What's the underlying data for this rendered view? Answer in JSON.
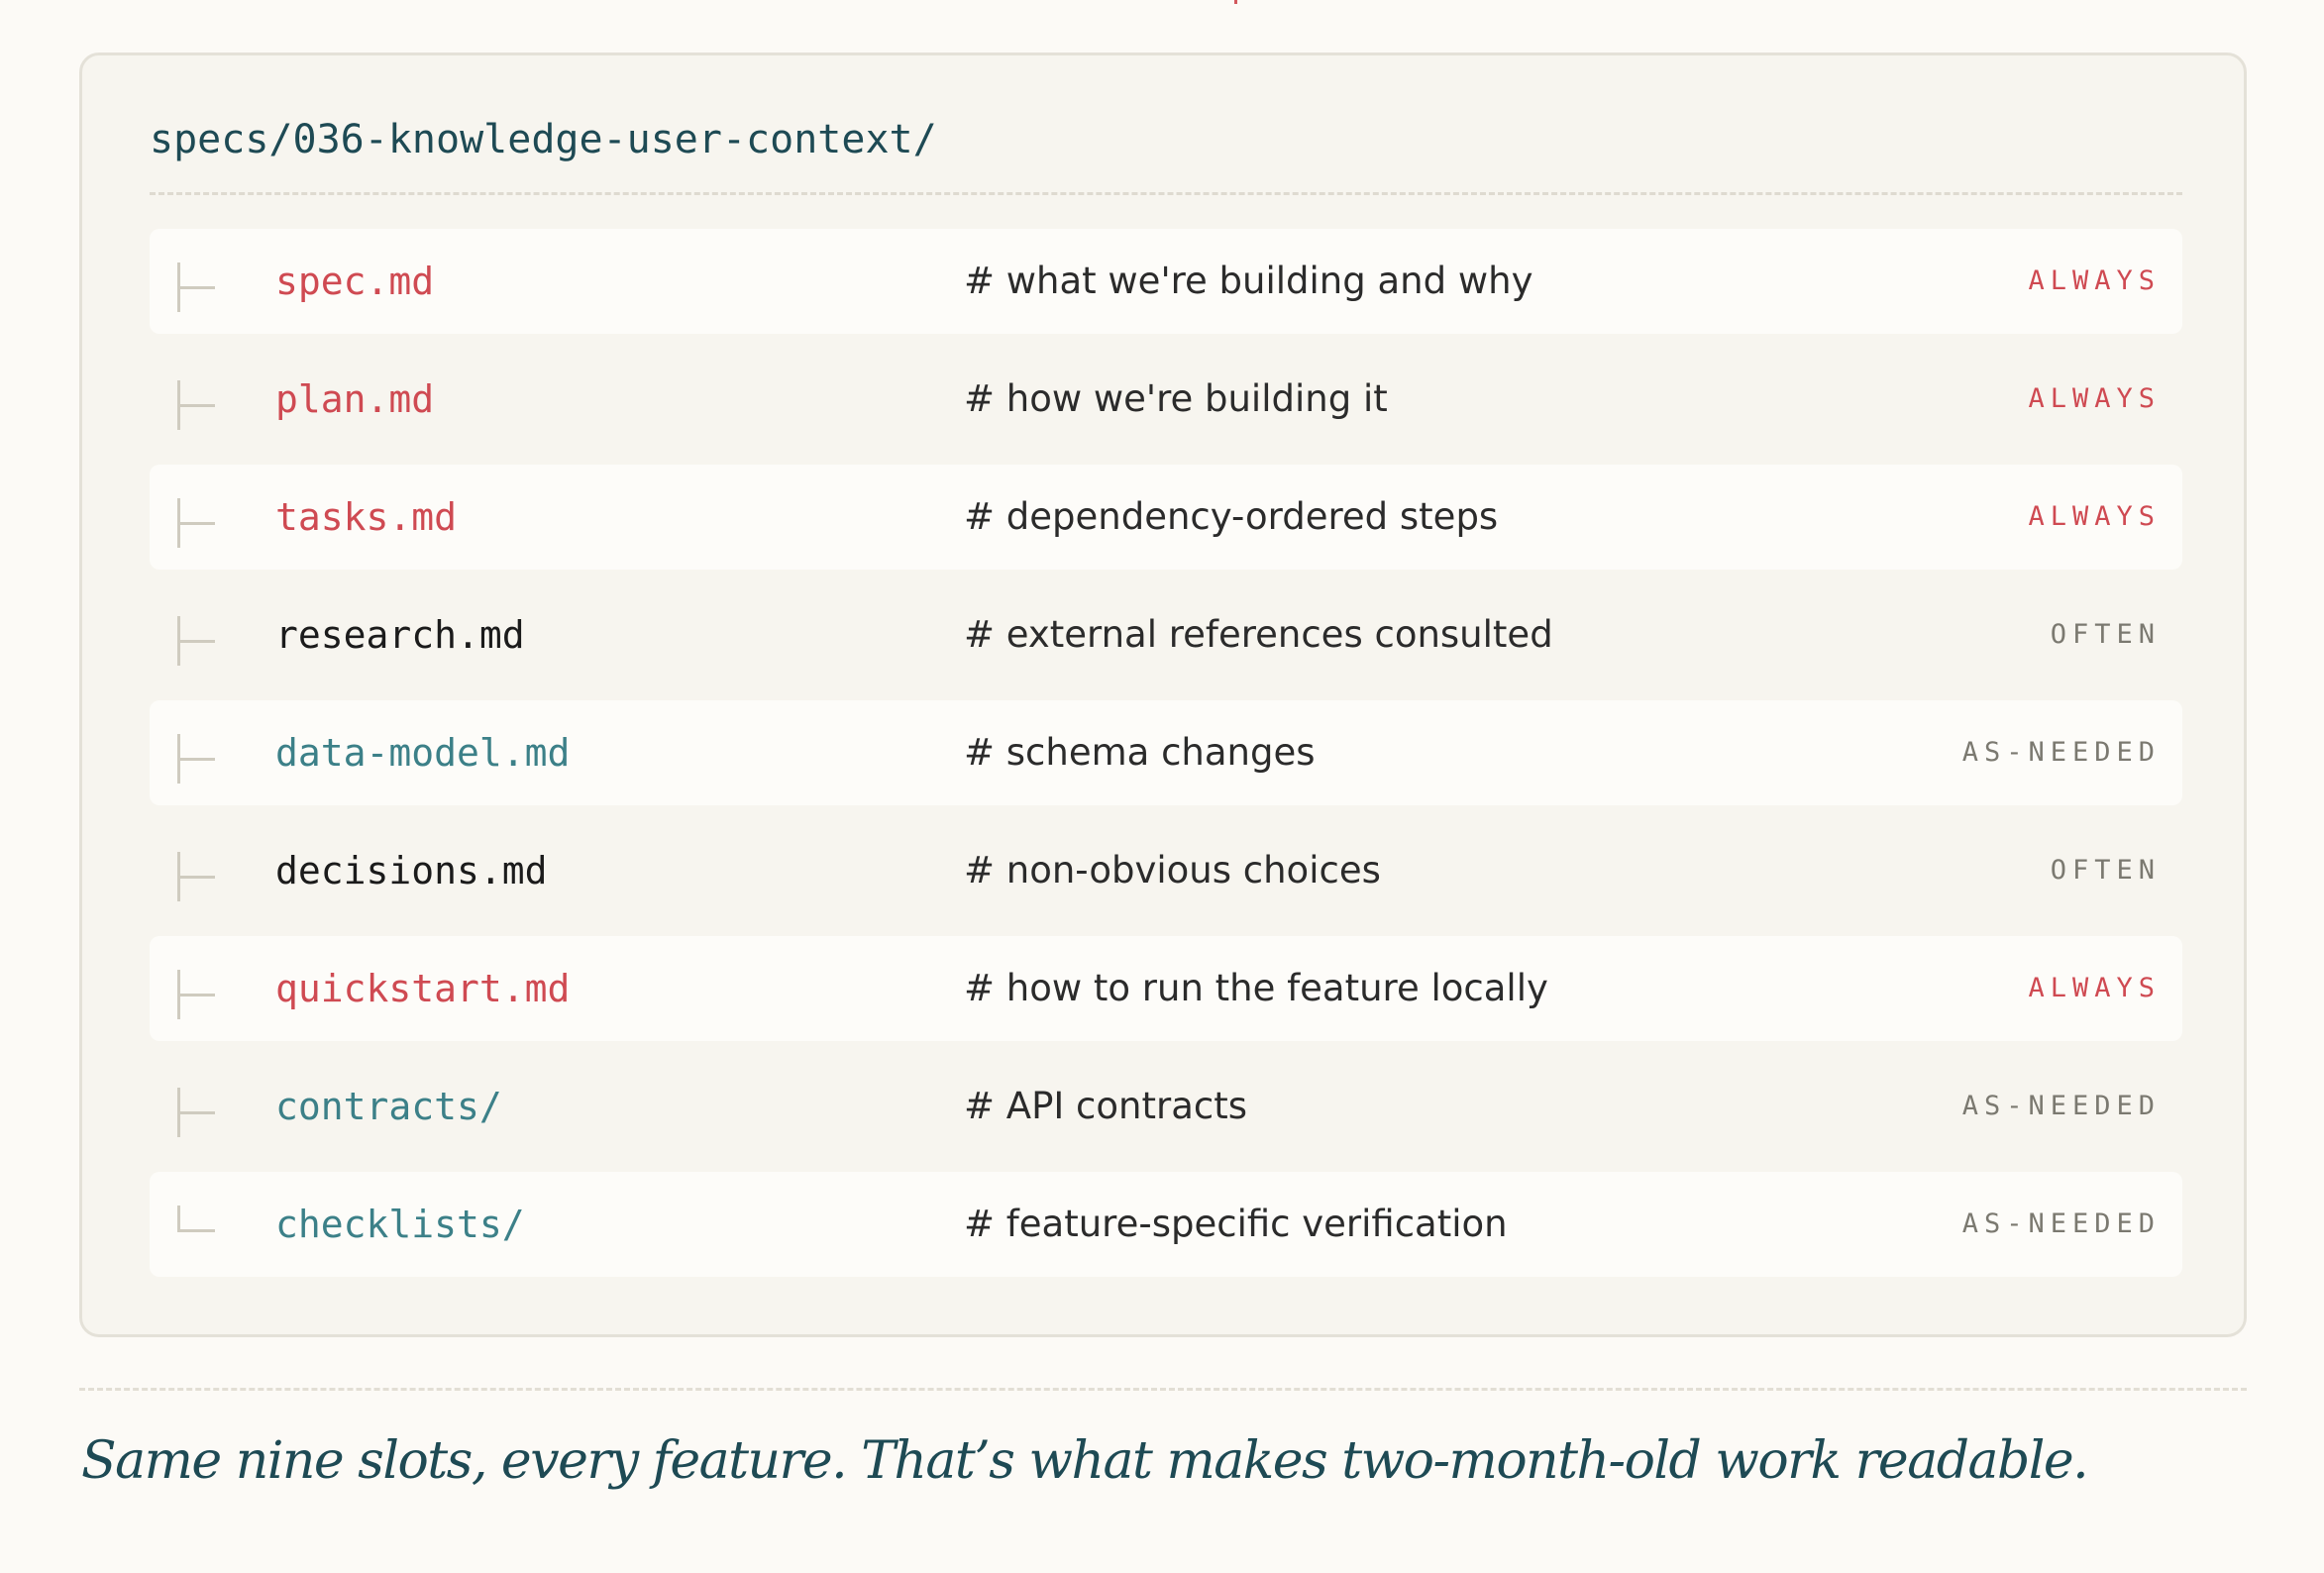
{
  "colors": {
    "accent_red": "#cf4a52",
    "accent_teal": "#3c8088",
    "ink": "#1e4a54",
    "muted": "#7b7970"
  },
  "tree": {
    "root_path": "specs/036-knowledge-user-context/",
    "items": [
      {
        "name": "spec.md",
        "comment": "# what we're building and why",
        "frequency": "ALWAYS",
        "name_color": "red",
        "row_style": "light",
        "glyph": "branch"
      },
      {
        "name": "plan.md",
        "comment": "# how we're building it",
        "frequency": "ALWAYS",
        "name_color": "red",
        "row_style": "plain",
        "glyph": "branch"
      },
      {
        "name": "tasks.md",
        "comment": "# dependency-ordered steps",
        "frequency": "ALWAYS",
        "name_color": "red",
        "row_style": "light",
        "glyph": "branch"
      },
      {
        "name": "research.md",
        "comment": "# external references consulted",
        "frequency": "OFTEN",
        "name_color": "dark",
        "row_style": "plain",
        "glyph": "branch"
      },
      {
        "name": "data-model.md",
        "comment": "# schema changes",
        "frequency": "AS-NEEDED",
        "name_color": "teal",
        "row_style": "light",
        "glyph": "branch"
      },
      {
        "name": "decisions.md",
        "comment": "# non-obvious choices",
        "frequency": "OFTEN",
        "name_color": "dark",
        "row_style": "plain",
        "glyph": "branch"
      },
      {
        "name": "quickstart.md",
        "comment": "# how to run the feature locally",
        "frequency": "ALWAYS",
        "name_color": "red",
        "row_style": "light",
        "glyph": "branch"
      },
      {
        "name": "contracts/",
        "comment": "# API contracts",
        "frequency": "AS-NEEDED",
        "name_color": "teal",
        "row_style": "plain",
        "glyph": "branch"
      },
      {
        "name": "checklists/",
        "comment": "# feature-specific verification",
        "frequency": "AS-NEEDED",
        "name_color": "teal",
        "row_style": "light",
        "glyph": "last"
      }
    ]
  },
  "caption": "Same nine slots, every feature. That’s what makes two-month-old work readable."
}
